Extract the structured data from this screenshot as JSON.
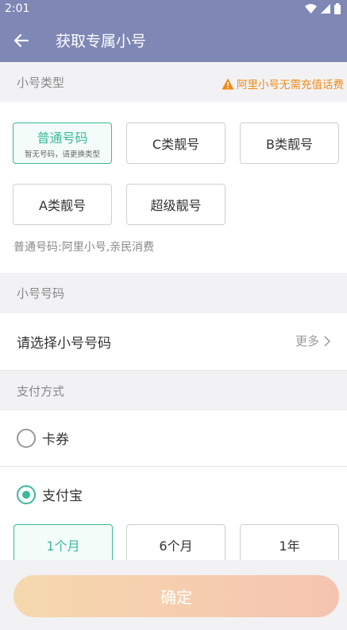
{
  "status": {
    "time": "2:01"
  },
  "appbar": {
    "title": "获取专属小号"
  },
  "number_type": {
    "header": "小号类型",
    "warning": "阿里小号无需充值话费",
    "chips": [
      {
        "label": "普通号码",
        "sub": "暂无号码，请更换类型",
        "selected": true
      },
      {
        "label": "C类靓号"
      },
      {
        "label": "B类靓号"
      },
      {
        "label": "A类靓号"
      },
      {
        "label": "超级靓号"
      }
    ],
    "description": "普通号码:阿里小号,亲民消费"
  },
  "number_select": {
    "header": "小号号码",
    "prompt": "请选择小号号码",
    "more": "更多"
  },
  "payment": {
    "header": "支付方式",
    "options": [
      {
        "label": "卡券",
        "selected": false
      },
      {
        "label": "支付宝",
        "selected": true
      }
    ],
    "durations": [
      {
        "label": "1个月",
        "selected": true
      },
      {
        "label": "6个月"
      },
      {
        "label": "1年"
      }
    ]
  },
  "confirm_label": "确定",
  "colors": {
    "primary_bar": "#7f87b5",
    "accent_green": "#3bb89a",
    "warning_orange": "#f28a16"
  }
}
